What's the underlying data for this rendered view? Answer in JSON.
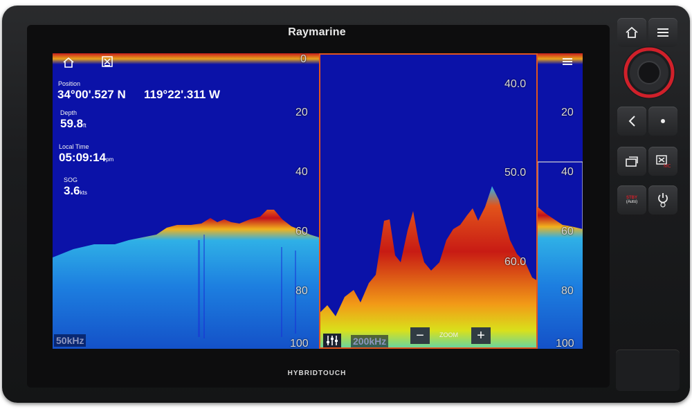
{
  "device": {
    "brand": "Raymarine",
    "footer": "HYBRIDTOUCH"
  },
  "overlay": {
    "position_label": "Position",
    "position_lat": "34°00'.527 N",
    "position_lon": "119°22'.311 W",
    "depth_label": "Depth",
    "depth_value": "59.8",
    "depth_unit": "ft",
    "time_label": "Local Time",
    "time_value": "05:09:14",
    "time_unit": "pm",
    "sog_label": "SOG",
    "sog_value": "3.6",
    "sog_unit": "kts"
  },
  "left_pane": {
    "frequency": "50kHz",
    "depth_scale": [
      "0",
      "20",
      "40",
      "60",
      "80",
      "100"
    ]
  },
  "zoom_pane": {
    "frequency": "200kHz",
    "zoom_label": "ZOOM",
    "zoom_out_symbol": "−",
    "zoom_in_symbol": "+",
    "depth_scale": [
      "40.0",
      "50.0",
      "60.0"
    ]
  },
  "right_pane": {
    "depth_scale": [
      "20",
      "40",
      "60",
      "80",
      "100"
    ]
  },
  "hardware_buttons": {
    "pilot_label_top": "STBY",
    "pilot_label_bottom": "(Auto)"
  },
  "icons": [
    "home-icon",
    "waypoint-icon",
    "menu-icon",
    "settings-sliders-icon",
    "back-icon",
    "ok-dot-icon",
    "switch-panes-icon",
    "mob-icon",
    "power-icon"
  ],
  "colors": {
    "water": "#0b12a8",
    "active_pane_border": "#e2551f",
    "knob_ring": "#d0202a"
  }
}
